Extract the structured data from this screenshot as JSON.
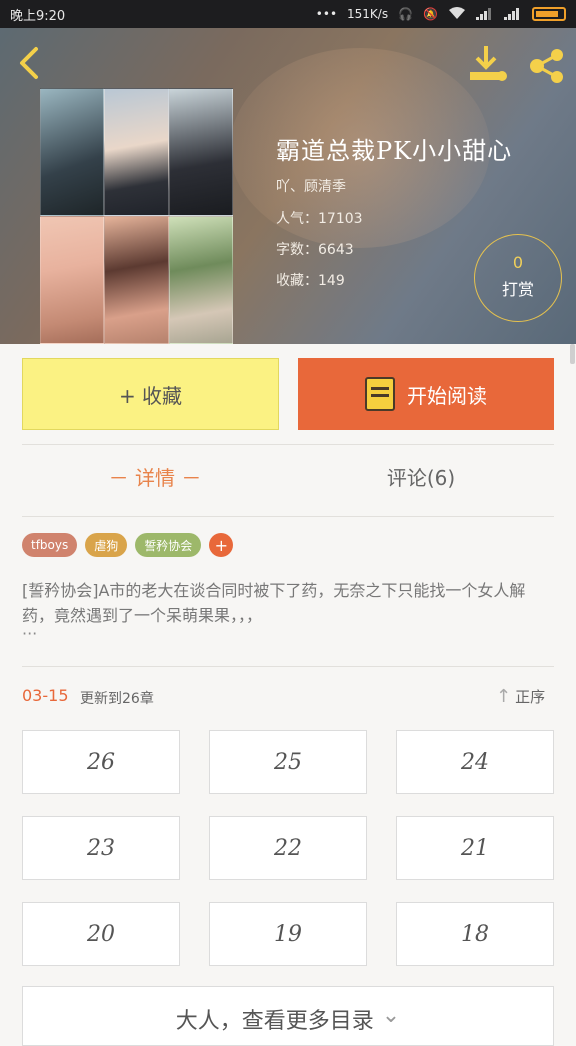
{
  "status_bar": {
    "time": "晚上9:20",
    "net_speed": "151K/s",
    "dots": "•••"
  },
  "book": {
    "title": "霸道总裁PK小小甜心",
    "author": "吖、顾清季",
    "popularity": "人气：17103",
    "word_count": "字数：6643",
    "favorites": "收藏：149"
  },
  "reward": {
    "count": "0",
    "label": "打赏"
  },
  "actions": {
    "favorite_label": "+ 收藏",
    "read_label": "开始阅读"
  },
  "tabs": {
    "detail": "－ 详情 －",
    "comments": "评论(6)"
  },
  "tags": [
    {
      "label": "tfboys",
      "color": "#d0836d"
    },
    {
      "label": "虐狗",
      "color": "#d9a44a"
    },
    {
      "label": "誓矜协会",
      "color": "#9db86a"
    },
    {
      "label": "+",
      "color": "#e8683a"
    }
  ],
  "description": "[誓矜协会]A市的老大在谈合同时被下了药，无奈之下只能找一个女人解药，竟然遇到了一个呆萌果果，，，",
  "description_more": "···",
  "update": {
    "date": "03-15",
    "text": "更新到26章",
    "sort_label": "正序"
  },
  "chapters": [
    "26",
    "25",
    "24",
    "23",
    "22",
    "21",
    "20",
    "19",
    "18"
  ],
  "more_label": "大人，查看更多目录",
  "colors": {
    "accent_orange": "#e8683a",
    "fav_yellow": "#fbf283",
    "gold": "#f4d04a"
  }
}
